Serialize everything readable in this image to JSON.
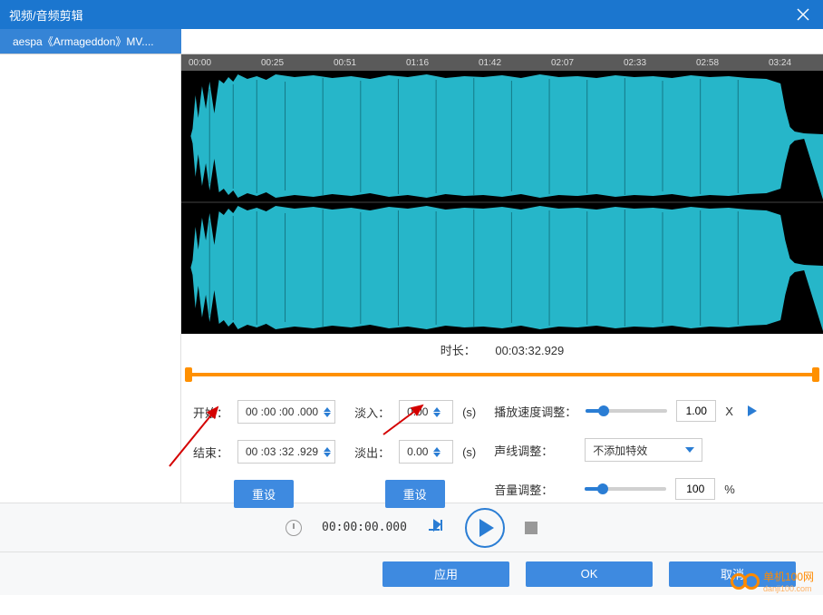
{
  "window": {
    "title": "视频/音频剪辑"
  },
  "tab": {
    "filename": "aespa《Armageddon》MV...."
  },
  "ruler": {
    "ticks": [
      "00:00",
      "00:25",
      "00:51",
      "01:16",
      "01:42",
      "02:07",
      "02:33",
      "02:58",
      "03:24"
    ]
  },
  "duration": {
    "label": "时长：",
    "value": "00:03:32.929"
  },
  "controls": {
    "start_label": "开始：",
    "start_value": "00 :00 :00 .000",
    "end_label": "结束：",
    "end_value": "00 :03 :32 .929",
    "reset1": "重设",
    "fadein_label": "淡入：",
    "fadein_value": "0.00",
    "fadeout_label": "淡出：",
    "fadeout_value": "0.00",
    "seconds_unit": "(s)",
    "reset2": "重设",
    "speed_label": "播放速度调整：",
    "speed_value": "1.00",
    "speed_unit": "X",
    "voice_label": "声线调整：",
    "voice_value": "不添加特效",
    "volume_label": "音量调整：",
    "volume_value": "100",
    "volume_unit": "%"
  },
  "playbar": {
    "time": "00:00:00.000"
  },
  "footer": {
    "apply": "应用",
    "ok": "OK",
    "cancel": "取消"
  },
  "watermark": {
    "text": "单机100网",
    "url": "danji100.com"
  }
}
